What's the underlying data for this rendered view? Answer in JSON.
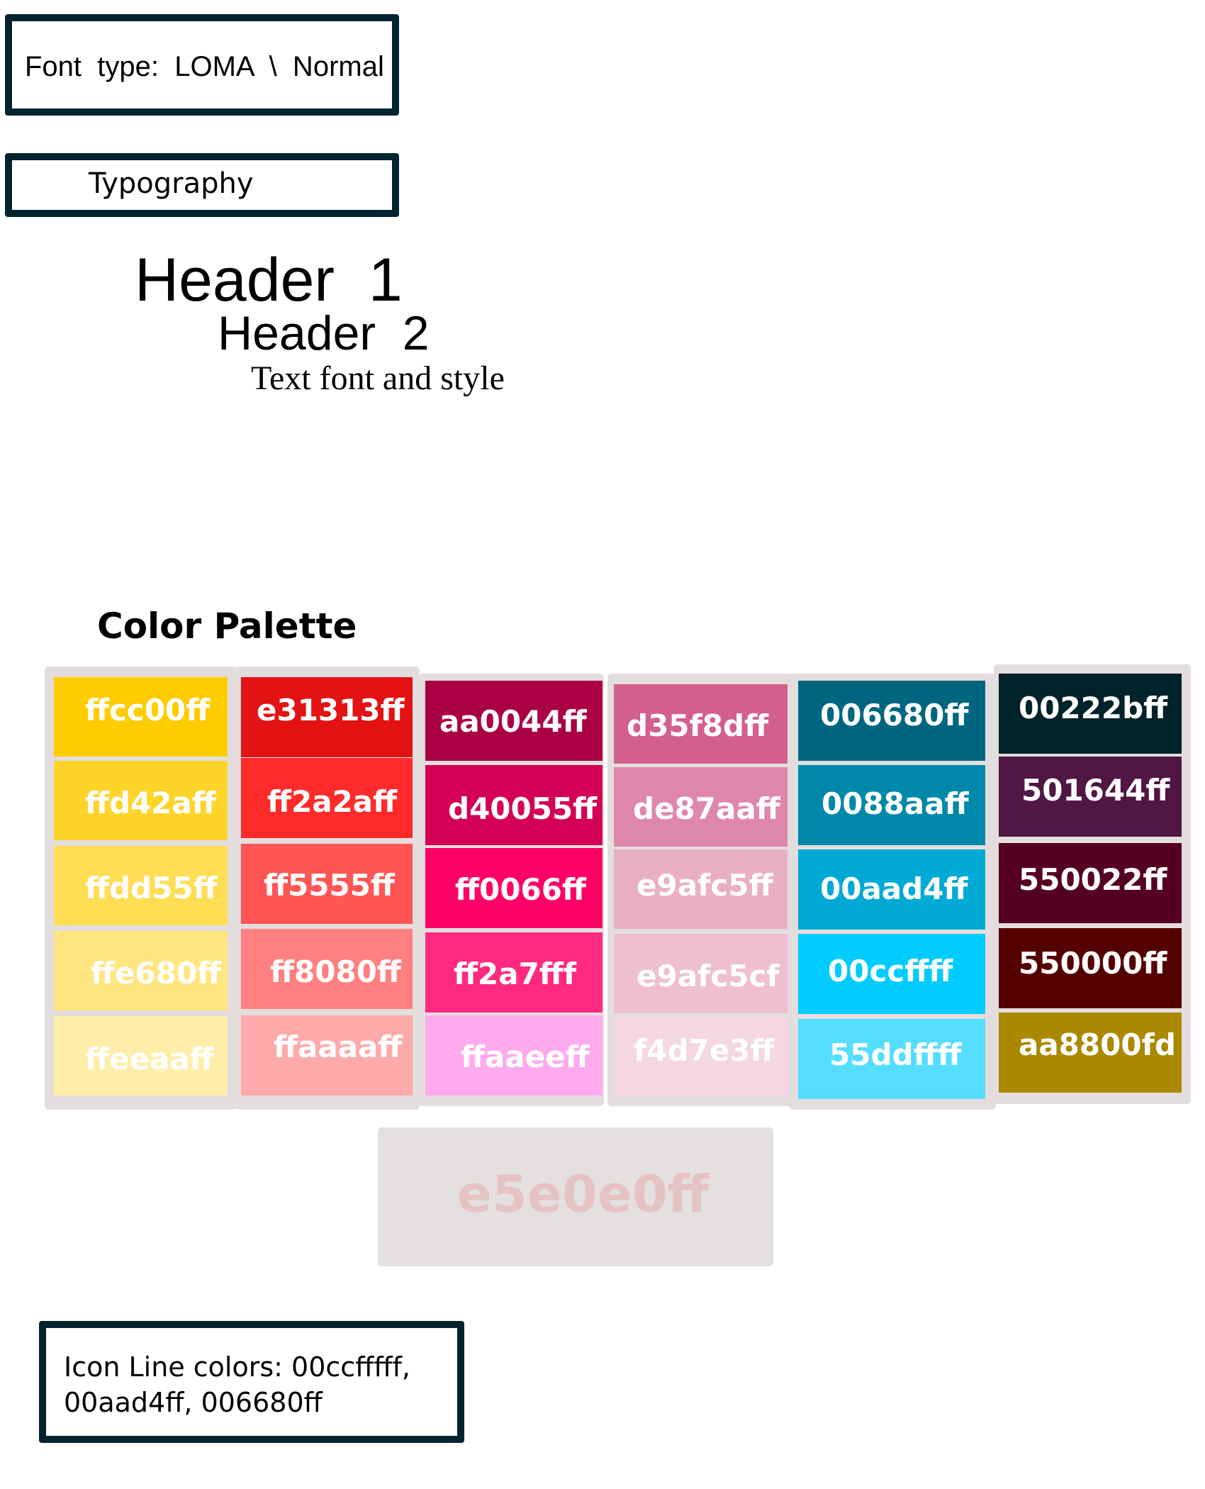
{
  "font_label": "Font  type:  LOMA  \\  Normal",
  "typography_label": "Typography",
  "header1": "Header  1",
  "header2": "Header  2",
  "body_text": "Text font and style",
  "palette_title": "Color Palette",
  "columns": [
    {
      "swatches": [
        {
          "label": "ffcc00ff",
          "color": "#ffcc00"
        },
        {
          "label": "ffd42aff",
          "color": "#ffd42a"
        },
        {
          "label": "ffdd55ff",
          "color": "#ffdd55"
        },
        {
          "label": "ffe680ff",
          "color": "#ffe680"
        },
        {
          "label": "ffeeaaff",
          "color": "#ffeeaa"
        }
      ]
    },
    {
      "swatches": [
        {
          "label": "e31313ff",
          "color": "#e31313"
        },
        {
          "label": "ff2a2aff",
          "color": "#ff2a2a"
        },
        {
          "label": "ff5555ff",
          "color": "#ff5555"
        },
        {
          "label": "ff8080ff",
          "color": "#ff8080"
        },
        {
          "label": "ffaaaaff",
          "color": "#ffaaaa"
        }
      ]
    },
    {
      "swatches": [
        {
          "label": "aa0044ff",
          "color": "#aa0044"
        },
        {
          "label": "d40055ff",
          "color": "#d40055"
        },
        {
          "label": "ff0066ff",
          "color": "#ff0066"
        },
        {
          "label": "ff2a7fff",
          "color": "#ff2a7f"
        },
        {
          "label": "ffaaeeff",
          "color": "#ffaaee"
        }
      ]
    },
    {
      "swatches": [
        {
          "label": "d35f8dff",
          "color": "#d35f8d"
        },
        {
          "label": "de87aaff",
          "color": "#de87aa"
        },
        {
          "label": "e9afc5ff",
          "color": "#e9afc5"
        },
        {
          "label": "e9afc5cf",
          "color": "#eebfd1"
        },
        {
          "label": "f4d7e3ff",
          "color": "#f4d7e3"
        }
      ]
    },
    {
      "swatches": [
        {
          "label": "006680ff",
          "color": "#006680"
        },
        {
          "label": "0088aaff",
          "color": "#0088aa"
        },
        {
          "label": "00aad4ff",
          "color": "#00aad4"
        },
        {
          "label": "00ccffff",
          "color": "#00ccff"
        },
        {
          "label": "55ddffff",
          "color": "#55ddff"
        }
      ]
    },
    {
      "swatches": [
        {
          "label": "00222bff",
          "color": "#00222b"
        },
        {
          "label": "501644ff",
          "color": "#501644"
        },
        {
          "label": "550022ff",
          "color": "#550022"
        },
        {
          "label": "550000ff",
          "color": "#550000"
        },
        {
          "label": "aa8800fd",
          "color": "#aa8800"
        }
      ]
    }
  ],
  "neutral": {
    "label": "e5e0e0ff",
    "color": "#e5e0e0"
  },
  "icon_line_colors": "Icon Line colors: 00ccfffff, 00aad4ff, 006680ff",
  "border_color": "#022430"
}
